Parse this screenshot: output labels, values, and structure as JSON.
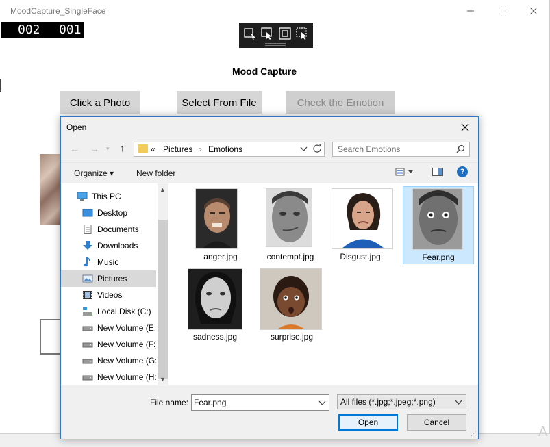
{
  "app": {
    "title": "MoodCapture_SingleFace",
    "counter_left": "002",
    "counter_right": "001",
    "heading": "Mood Capture",
    "buttons": {
      "click_photo": "Click a Photo",
      "select_file": "Select From File",
      "check_emotion": "Check the Emotion"
    },
    "watermark": "A"
  },
  "dialog": {
    "title": "Open",
    "breadcrumb": [
      "«",
      "Pictures",
      "›",
      "Emotions"
    ],
    "search_placeholder": "Search Emotions",
    "commands": {
      "organize": "Organize ▾",
      "new_folder": "New folder"
    },
    "nav_items": [
      {
        "label": "This PC",
        "icon": "this-pc-icon"
      },
      {
        "label": "Desktop",
        "icon": "desktop-icon"
      },
      {
        "label": "Documents",
        "icon": "documents-icon"
      },
      {
        "label": "Downloads",
        "icon": "downloads-icon"
      },
      {
        "label": "Music",
        "icon": "music-icon"
      },
      {
        "label": "Pictures",
        "icon": "pictures-icon",
        "selected": true
      },
      {
        "label": "Videos",
        "icon": "videos-icon"
      },
      {
        "label": "Local Disk (C:)",
        "icon": "drive-icon"
      },
      {
        "label": "New Volume (E:)",
        "icon": "drive-icon"
      },
      {
        "label": "New Volume (F:)",
        "icon": "drive-icon"
      },
      {
        "label": "New Volume (G:)",
        "icon": "drive-icon"
      },
      {
        "label": "New Volume (H:)",
        "icon": "drive-icon"
      }
    ],
    "files": [
      {
        "name": "anger.jpg"
      },
      {
        "name": "contempt.jpg"
      },
      {
        "name": "Disgust.jpg"
      },
      {
        "name": "Fear.png",
        "selected": true
      },
      {
        "name": "sadness.jpg"
      },
      {
        "name": "surprise.jpg"
      }
    ],
    "file_name_label": "File name:",
    "file_name_value": "Fear.png",
    "filter_value": "All files (*.jpg;*.jpeg;*.png)",
    "open_label": "Open",
    "cancel_label": "Cancel"
  },
  "colors": {
    "accent": "#0078d7",
    "selection": "#cce8ff",
    "dialog_border": "#2b78c5"
  }
}
